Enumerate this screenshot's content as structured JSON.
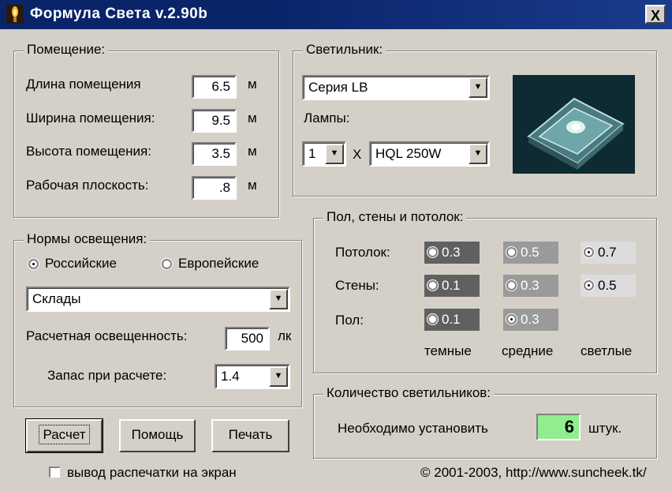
{
  "window": {
    "title": "Формула Света v.2.90b",
    "close_label": "X"
  },
  "room": {
    "title": "Помещение:",
    "fields": [
      {
        "label": "Длина помещения",
        "value": "6.5",
        "unit": "м"
      },
      {
        "label": "Ширина помещения:",
        "value": "9.5",
        "unit": "м"
      },
      {
        "label": "Высота помещения:",
        "value": "3.5",
        "unit": "м"
      },
      {
        "label": "Рабочая плоскость:",
        "value": ".8",
        "unit": "м"
      }
    ]
  },
  "luminaire": {
    "title": "Светильник:",
    "series": "Серия LB",
    "lamps_label": "Лампы:",
    "lamp_count": "1",
    "times": "X",
    "lamp_type": "HQL 250W"
  },
  "reflect": {
    "title": "Пол, стены и потолок:",
    "rows": [
      {
        "label": "Потолок:",
        "options": [
          "0.3",
          "0.5",
          "0.7"
        ],
        "selected": 2
      },
      {
        "label": "Стены:",
        "options": [
          "0.1",
          "0.3",
          "0.5"
        ],
        "selected": 2
      },
      {
        "label": "Пол:",
        "options": [
          "0.1",
          "0.3"
        ],
        "selected": 1
      }
    ],
    "columns": [
      "темные",
      "средние",
      "светлые"
    ],
    "colors": {
      "dark": "#606060",
      "medium": "#9a9a9a",
      "light": "#dcdcdc"
    }
  },
  "norms": {
    "title": "Нормы освещения:",
    "option_ru": "Российские",
    "option_eu": "Европейские",
    "selected": "ru",
    "category": "Склады",
    "illum_label": "Расчетная освещенность:",
    "illum_value": "500",
    "illum_unit": "лк",
    "reserve_label": "Запас при расчете:",
    "reserve_value": "1.4"
  },
  "count": {
    "title": "Количество светильников:",
    "label": "Необходимо установить",
    "value": "6",
    "unit": "штук."
  },
  "buttons": {
    "calc": "Расчет",
    "help": "Помощь",
    "print": "Печать"
  },
  "print_to_screen": {
    "label": "вывод распечатки на экран",
    "checked": false
  },
  "copyright": "© 2001-2003, http://www.suncheek.tk/"
}
